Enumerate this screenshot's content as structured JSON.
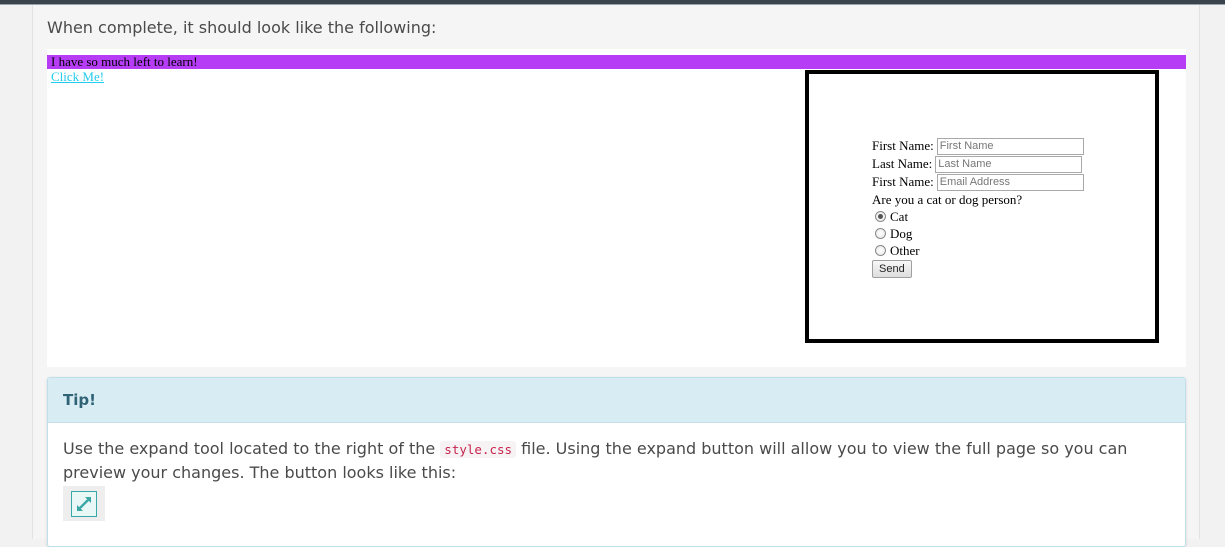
{
  "intro": {
    "text": "When complete, it should look like the following:"
  },
  "preview": {
    "banner_text": "I have so much left to learn!",
    "link_text": "Click Me!",
    "form": {
      "fields": [
        {
          "label": "First Name:",
          "placeholder": "First Name"
        },
        {
          "label": "Last Name:",
          "placeholder": "Last Name"
        },
        {
          "label": "First Name:",
          "placeholder": "Email Address"
        }
      ],
      "question": "Are you a cat or dog person?",
      "options": [
        {
          "label": "Cat",
          "selected": true
        },
        {
          "label": "Dog",
          "selected": false
        },
        {
          "label": "Other",
          "selected": false
        }
      ],
      "submit_label": "Send"
    }
  },
  "tip": {
    "title": "Tip!",
    "body_before": "Use the expand tool located to the right of the ",
    "code": "style.css",
    "body_after": " file. Using the expand button will allow you to view the full page so you can preview your changes. The button looks like this:",
    "icon": "expand-icon"
  },
  "colors": {
    "banner_bg": "#b63cf6",
    "link": "#22ccee",
    "tip_header_bg": "#d8ecf4",
    "tip_title": "#2f6275",
    "code_text": "#c7254e",
    "expand_icon": "#3aa7a7"
  }
}
